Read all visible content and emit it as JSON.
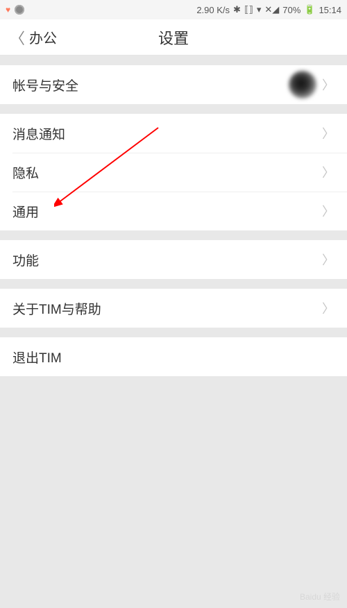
{
  "status": {
    "speed": "2.90 K/s",
    "battery": "70%",
    "time": "15:14"
  },
  "nav": {
    "back_label": "办公",
    "title": "设置"
  },
  "sections": {
    "account": {
      "label": "帐号与安全"
    },
    "notif": {
      "label": "消息通知"
    },
    "privacy": {
      "label": "隐私"
    },
    "general": {
      "label": "通用"
    },
    "features": {
      "label": "功能"
    },
    "about": {
      "label": "关于TIM与帮助"
    },
    "logout": {
      "label": "退出TIM"
    }
  },
  "watermark": "Baidu 经验"
}
